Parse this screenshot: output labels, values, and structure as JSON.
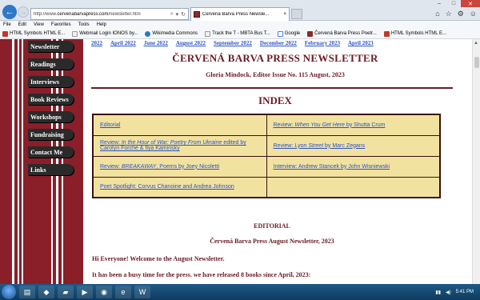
{
  "browser": {
    "url_prefix": "http://www.",
    "url_domain": "cervenabarvapress.com",
    "url_path": "/newsletter.htm",
    "tab_title": "Červená Barva Press Newsle...",
    "menu": [
      "File",
      "Edit",
      "View",
      "Favorites",
      "Tools",
      "Help"
    ],
    "favorites": [
      {
        "label": "HTML Symbols HTML E...",
        "icon": "r-icon",
        "color": "#c0392b"
      },
      {
        "label": "Webmail Login IONOS by...",
        "icon": "page-icon",
        "color": "#f0f0f0"
      },
      {
        "label": "Wikimedia Commons",
        "icon": "wikimedia-icon",
        "color": "#2a7bc4"
      },
      {
        "label": "Track the T - MBTA Bus T...",
        "icon": "page-icon",
        "color": "#f0f0f0"
      },
      {
        "label": "Google",
        "icon": "google-icon",
        "color": "#ffffff"
      },
      {
        "label": "Červená Barva Press Poetr...",
        "icon": "cbp-icon",
        "color": "#8a2a2a"
      },
      {
        "label": "HTML Symbols HTML E...",
        "icon": "r-icon",
        "color": "#c0392b"
      }
    ]
  },
  "sidebar": {
    "items": [
      "Newsletter",
      "Readings",
      "Interviews",
      "Book Reviews",
      "Workshops",
      "Fundraising",
      "Contact Me",
      "Links"
    ]
  },
  "archive_links": [
    "2022",
    "April 2022",
    "June 2022",
    "August 2022",
    "September 2022",
    "December 2022",
    "February 2023",
    "April 2023"
  ],
  "header": {
    "title": "ČERVENÁ BARVA PRESS NEWSLETTER",
    "subtitle": "Gloria Mindock, Editor   Issue No. 115   August, 2023",
    "index_title": "INDEX"
  },
  "index": {
    "r1c1": "Editorial",
    "r1c2_pre": "Review: ",
    "r1c2_title": "When You Get Here",
    "r1c2_post": " by Shutta Crum",
    "r2c1_pre": "Review: ",
    "r2c1_title": "In the Hour of War: Poetry From Ukraine",
    "r2c1_post": " edited by Carolyn Forché & Ilya Kaminsky",
    "r2c2_pre": "Review: ",
    "r2c2_title": "Lyon Street",
    "r2c2_post": " by Marc Zegans",
    "r3c1_pre": "Review: ",
    "r3c1_title": "BREAKAWAY",
    "r3c1_post": ", Poems by Joey Nicoletti",
    "r3c2": "Interview: Andrew Stancek by John Wisniewski",
    "r4c1": "Poet Spotlight: Corvus Chanoine and Andrea Johnson",
    "r4c2": ""
  },
  "editorial": {
    "heading": "EDITORIAL",
    "subheading": "Červená Barva Press August Newsletter, 2023",
    "p1": "Hi Everyone! Welcome to the August Newsletter.",
    "p2": "It has been a busy time for the press.  we have released 8 books since April, 2023:"
  },
  "taskbar": {
    "time": "5:41 PM"
  }
}
